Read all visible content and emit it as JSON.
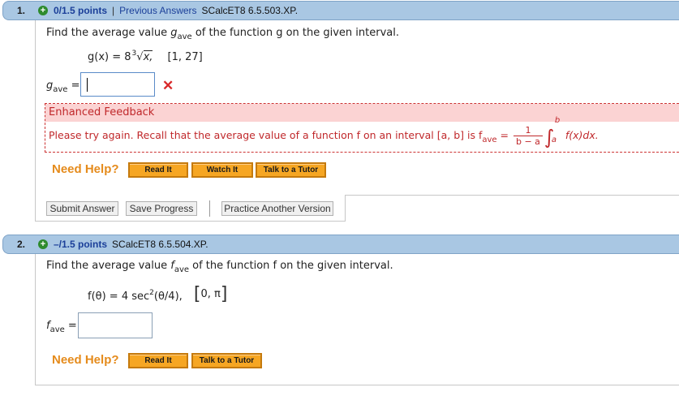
{
  "questions": [
    {
      "number": "1.",
      "points": "0/1.5 points",
      "previous_answers": "Previous Answers",
      "code": "SCalcET8 6.5.503.XP.",
      "prompt_pre": "Find the average value ",
      "prompt_var": "g",
      "prompt_sub": "ave",
      "prompt_post": " of the function g on the given interval.",
      "function_text": "g(x) = 8",
      "root_index": "3",
      "radicand": "x,",
      "interval": "[1, 27]",
      "answer_label": "g",
      "answer_sub": "ave",
      "answer_value": "",
      "feedback_title": "Enhanced Feedback",
      "feedback_text": "Please try again. Recall that the average value of a function f on an interval  [a, b]  is  f",
      "feedback_sub": "ave",
      "feedback_eq": " = ",
      "frac_num": "1",
      "frac_den": "b − a",
      "int_upper": "b",
      "int_lower": "a",
      "integrand": " f(x)dx.",
      "need_help": "Need Help?",
      "help_buttons": [
        "Read It",
        "Watch It",
        "Talk to a Tutor"
      ],
      "action_buttons": [
        "Submit Answer",
        "Save Progress",
        "Practice Another Version"
      ]
    },
    {
      "number": "2.",
      "points": "–/1.5 points",
      "code": "SCalcET8 6.5.504.XP.",
      "prompt_pre": "Find the average value ",
      "prompt_var": "f",
      "prompt_sub": "ave",
      "prompt_post": " of the function f on the given interval.",
      "function_text": "f(θ) = 4 sec",
      "function_sup": "2",
      "function_post": "(θ/4),",
      "interval_inner": "0, π",
      "answer_label": "f",
      "answer_sub": "ave",
      "answer_value": "",
      "need_help": "Need Help?",
      "help_buttons": [
        "Read It",
        "Talk to a Tutor"
      ]
    }
  ]
}
